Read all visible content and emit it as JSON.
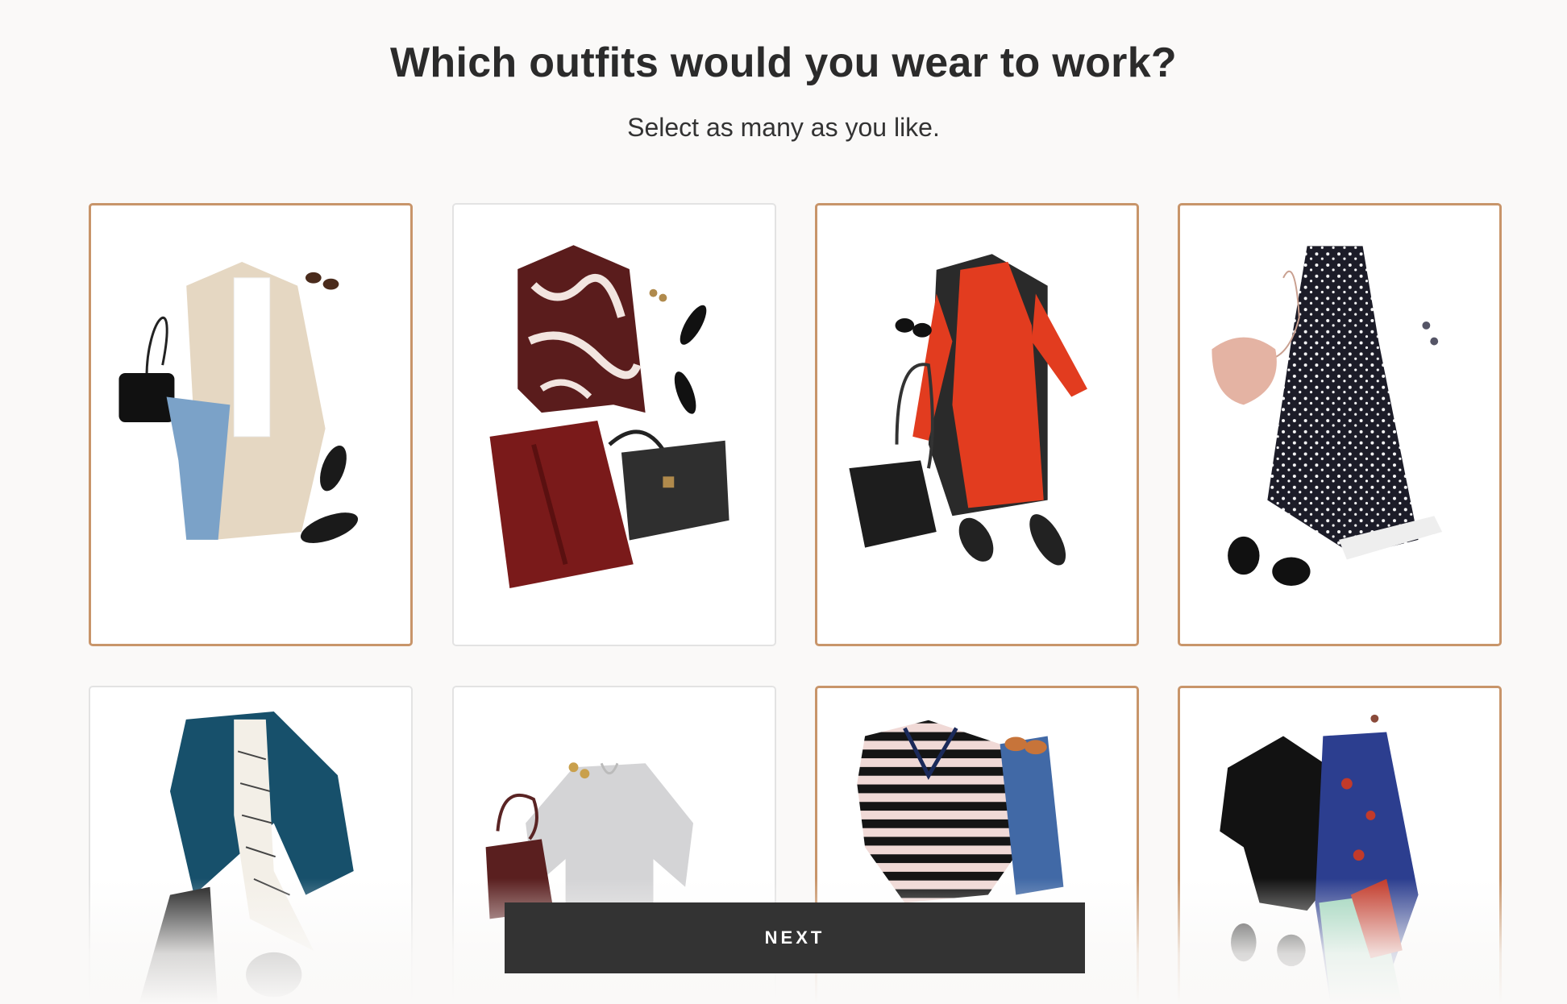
{
  "header": {
    "title": "Which outfits would you wear to work?",
    "subtitle": "Select as many as you like."
  },
  "outfits": [
    {
      "name": "outfit-camel-coat-jeans",
      "selected": true
    },
    {
      "name": "outfit-floral-blouse-burgundy-skirt",
      "selected": false
    },
    {
      "name": "outfit-red-dress-black-vest",
      "selected": true
    },
    {
      "name": "outfit-polka-dot-dress",
      "selected": true
    },
    {
      "name": "outfit-teal-blazer-striped-blouse",
      "selected": false
    },
    {
      "name": "outfit-grey-top-burgundy-bag",
      "selected": false
    },
    {
      "name": "outfit-striped-sweater-jeans",
      "selected": true
    },
    {
      "name": "outfit-leather-jacket-print-dress",
      "selected": true
    }
  ],
  "footer": {
    "next_label": "NEXT"
  },
  "colors": {
    "selected_border": "#c8956a",
    "button_bg": "#333333",
    "page_bg": "#faf9f8"
  }
}
